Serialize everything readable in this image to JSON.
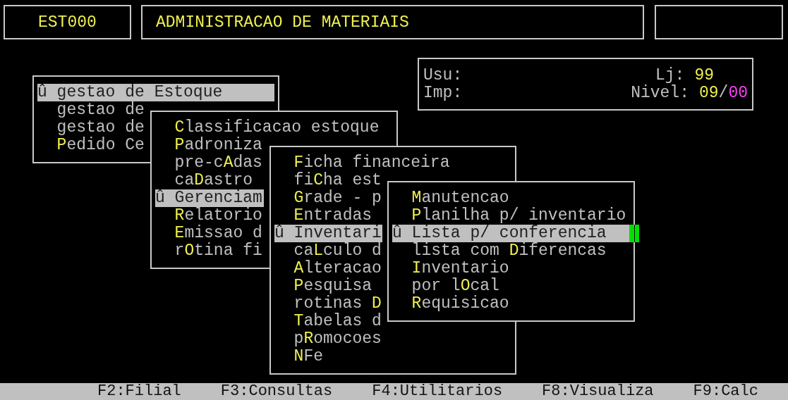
{
  "header": {
    "code": "EST000",
    "title": "ADMINISTRACAO DE MATERIAIS"
  },
  "info": {
    "user_label": "Usu:",
    "store_label": "Lj:",
    "store_value": "99",
    "printer_label": "Imp:",
    "level_label": "Nivel:",
    "level_value": "**09**/*00*"
  },
  "menus": [
    {
      "active": false,
      "items": [
        {
          "text": "gestao de **E**stoque",
          "selected": true,
          "marker": "û"
        },
        {
          "text": "gestao de",
          "selected": false
        },
        {
          "text": "gestao de",
          "selected": false
        },
        {
          "text": "**P**edido Ce",
          "selected": false
        }
      ]
    },
    {
      "active": false,
      "items": [
        {
          "text": "**C**lassificacao estoque",
          "selected": false
        },
        {
          "text": "**P**adroniza",
          "selected": false
        },
        {
          "text": "pre-c**A**das",
          "selected": false
        },
        {
          "text": "ca**D**astro",
          "selected": false
        },
        {
          "text": "Gerenciam",
          "selected": true,
          "marker": "û"
        },
        {
          "text": "**R**elatorio",
          "selected": false
        },
        {
          "text": "**E**missao d",
          "selected": false
        },
        {
          "text": "r**O**tina fi",
          "selected": false
        }
      ]
    },
    {
      "active": false,
      "items": [
        {
          "text": "**F**icha financeira",
          "selected": false
        },
        {
          "text": "fi**C**ha est",
          "selected": false
        },
        {
          "text": "**G**rade - p",
          "selected": false
        },
        {
          "text": "**E**ntradas",
          "selected": false
        },
        {
          "text": "Inventari",
          "selected": true,
          "marker": "û"
        },
        {
          "text": "ca**L**culo d",
          "selected": false
        },
        {
          "text": "**A**lteracao",
          "selected": false
        },
        {
          "text": "**P**esquisa",
          "selected": false
        },
        {
          "text": "rotinas **D**",
          "selected": false
        },
        {
          "text": "**T**abelas d",
          "selected": false
        },
        {
          "text": "p**R**omocoes",
          "selected": false
        },
        {
          "text": "**N**Fe",
          "selected": false
        }
      ]
    },
    {
      "active": true,
      "items": [
        {
          "text": "**M**anutencao",
          "selected": false
        },
        {
          "text": "**P**lanilha p/ inventario",
          "selected": false
        },
        {
          "text": "Lista p/ conferencia",
          "selected": true,
          "marker": "û"
        },
        {
          "text": "lista com **D**iferencas",
          "selected": false
        },
        {
          "text": "**I**nventario",
          "selected": false
        },
        {
          "text": "por l**O**cal",
          "selected": false
        },
        {
          "text": "**R**equisicao",
          "selected": false
        }
      ]
    }
  ],
  "status_bar": [
    "F2:Filial",
    "F3:Consultas",
    "F4:Utilitarios",
    "F8:Visualiza",
    "F9:Calc"
  ]
}
